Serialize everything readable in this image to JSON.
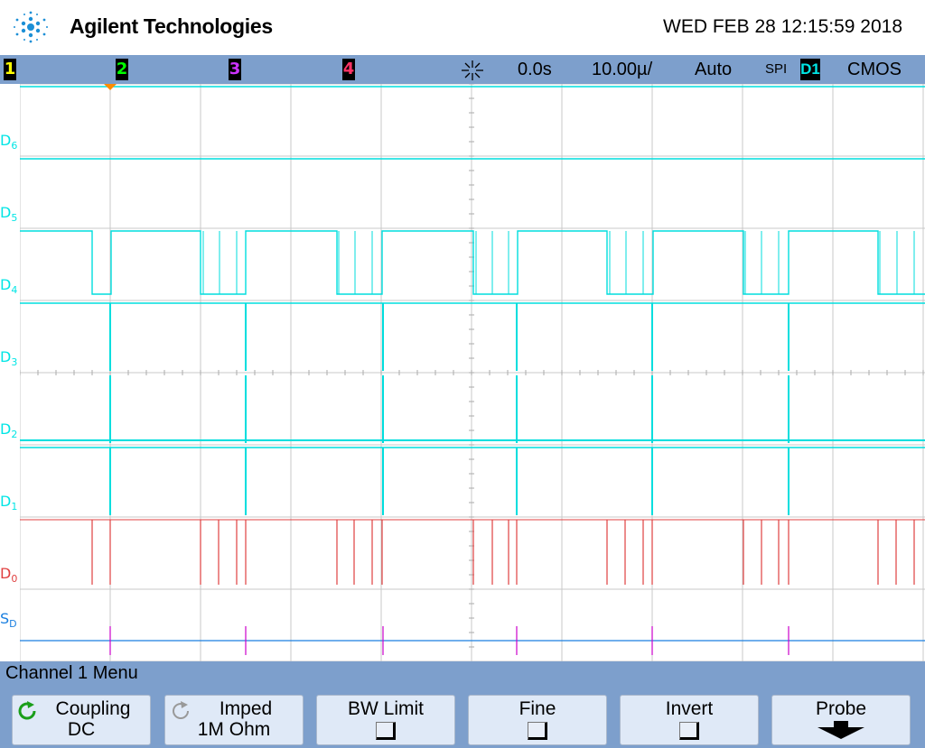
{
  "header": {
    "brand": "Agilent Technologies",
    "datetime": "WED FEB 28 12:15:59 2018"
  },
  "statusbar": {
    "channels": [
      {
        "label": "1",
        "color": "#ffff00"
      },
      {
        "label": "2",
        "color": "#00ff00"
      },
      {
        "label": "3",
        "color": "#cc33ff"
      },
      {
        "label": "4",
        "color": "#ff3366"
      }
    ],
    "trigger_position": "0.0s",
    "timebase": "10.00µ/",
    "trigger_mode": "Auto",
    "protocol": "SPI",
    "source": "D1",
    "logic_level": "CMOS"
  },
  "waveform": {
    "labels": [
      {
        "base": "D",
        "sub": "6",
        "color": "#00e5e5"
      },
      {
        "base": "D",
        "sub": "5",
        "color": "#00e5e5"
      },
      {
        "base": "D",
        "sub": "4",
        "color": "#00e5e5"
      },
      {
        "base": "D",
        "sub": "3",
        "color": "#00e5e5"
      },
      {
        "base": "D",
        "sub": "2",
        "color": "#00e5e5"
      },
      {
        "base": "D",
        "sub": "1",
        "color": "#00e5e5"
      },
      {
        "base": "D",
        "sub": "0",
        "color": "#e04040"
      },
      {
        "base": "S",
        "sub": "D",
        "color": "#1a7fe0"
      }
    ]
  },
  "menu": {
    "title": "Channel 1  Menu",
    "softkeys": [
      {
        "label": "Coupling",
        "value": "DC"
      },
      {
        "label": "Imped",
        "value": "1M Ohm"
      },
      {
        "label": "BW Limit"
      },
      {
        "label": "Fine"
      },
      {
        "label": "Invert"
      },
      {
        "label": "Probe"
      }
    ]
  }
}
